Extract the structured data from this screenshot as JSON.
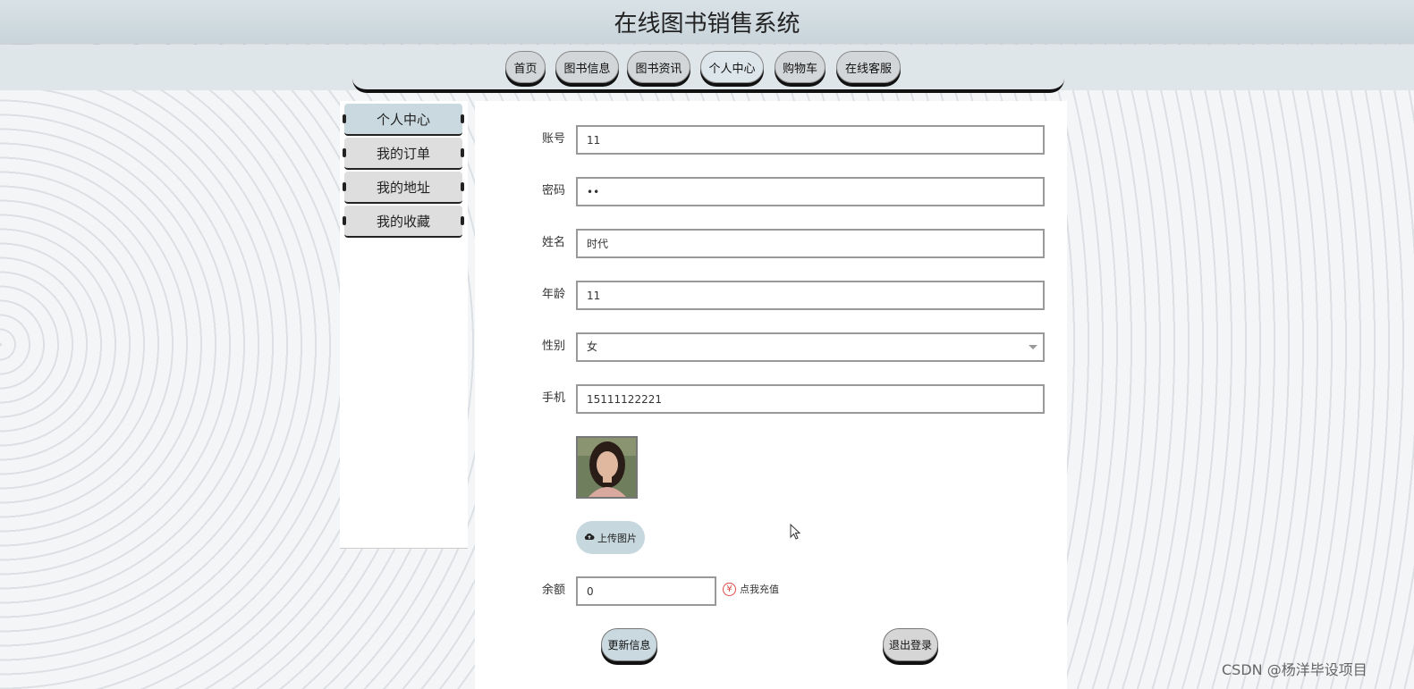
{
  "site_title": "在线图书销售系统",
  "nav": {
    "home": "首页",
    "book_info": "图书信息",
    "book_news": "图书资讯",
    "profile": "个人中心",
    "cart": "购物车",
    "service": "在线客服"
  },
  "sidebar": {
    "items": [
      {
        "label": "个人中心",
        "active": true
      },
      {
        "label": "我的订单",
        "active": false
      },
      {
        "label": "我的地址",
        "active": false
      },
      {
        "label": "我的收藏",
        "active": false
      }
    ]
  },
  "form": {
    "account": {
      "label": "账号",
      "value": "11"
    },
    "password": {
      "label": "密码",
      "value": "11"
    },
    "name": {
      "label": "姓名",
      "value": "时代"
    },
    "age": {
      "label": "年龄",
      "value": "11"
    },
    "gender": {
      "label": "性别",
      "value": "女"
    },
    "phone": {
      "label": "手机",
      "value": "15111122221"
    },
    "upload_label": "上传图片",
    "balance": {
      "label": "余额",
      "value": "0"
    },
    "recharge_label": "点我充值",
    "recharge_symbol": "¥"
  },
  "actions": {
    "update": "更新信息",
    "logout": "退出登录"
  },
  "watermark": "CSDN @杨洋毕设项目",
  "colors": {
    "active_tab": "#dde6ea",
    "active_side": "#c9d9df",
    "upload_btn": "#c6d7dd",
    "recharge_icon": "#e04848"
  }
}
